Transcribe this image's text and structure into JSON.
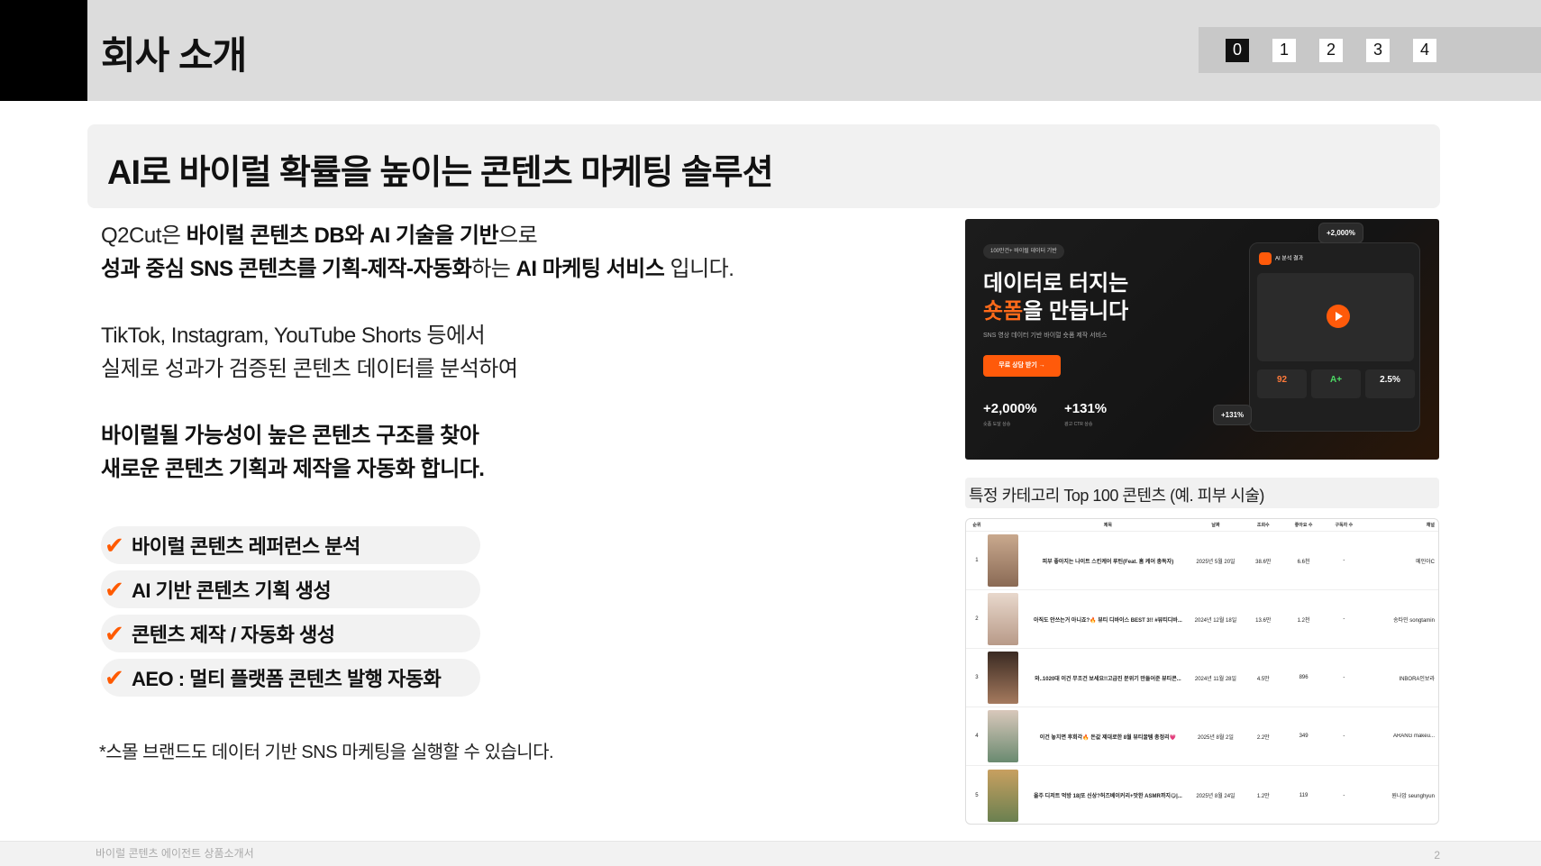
{
  "header": {
    "title": "회사 소개",
    "pages": [
      "0",
      "1",
      "2",
      "3",
      "4"
    ],
    "active_page": "0"
  },
  "headline": "AI로 바이럴 확률을 높이는 콘텐츠 마케팅 솔루션",
  "intro": {
    "p1_a": "Q2Cut은 ",
    "p1_b": "바이럴 콘텐츠 DB와 AI 기술을 기반",
    "p1_c": "으로",
    "p1_d": "성과 중심 SNS 콘텐츠를 기획-제작-자동화",
    "p1_e": "하는 ",
    "p1_f": "AI 마케팅 서비스",
    "p1_g": " 입니다.",
    "p2_line1": "TikTok, Instagram, YouTube Shorts 등에서",
    "p2_line2": "실제로 성과가 검증된 콘텐츠 데이터를 분석하여",
    "p3_line1": "바이럴될 가능성이 높은 콘텐츠 구조를 찾아",
    "p3_line2": "새로운 콘텐츠 기획과 제작을 자동화 합니다."
  },
  "features": [
    "바이럴 콘텐츠 레퍼런스 분석",
    "AI 기반 콘텐츠 기획 생성",
    "콘텐츠 제작 / 자동화 생성",
    "AEO : 멀티 플랫폼 콘텐츠 발행 자동화"
  ],
  "check_glyph": "✔",
  "accent_color": "#ff5a00",
  "footnote": "*스몰 브랜드도 데이터 기반 SNS 마케팅을 실행할 수 있습니다.",
  "hero": {
    "badge": "100만건+ 바이럴 데이터 기반",
    "title_line1": "데이터로 터지는",
    "title_hl": "숏폼",
    "title_line2_rest": "을 만듭니다",
    "subtitle": "SNS 영상 데이터 기반 바이럴 숏폼 제작 서비스",
    "cta": "무료 상담 받기 →",
    "stat1": "+2,000%",
    "stat1_sub": "숏폼 도달 상승",
    "stat2": "+131%",
    "stat2_sub": "광고 CTR 상승",
    "panel_title": "AI 분석 결과",
    "metric1": "92",
    "metric2": "A+",
    "metric3": "2.5%",
    "float1": "+2,000%",
    "float2": "+131%"
  },
  "caption": "특정 카테고리 Top 100 콘텐츠 (예. 피부 시술)",
  "table": {
    "headers": [
      "순위",
      "제목",
      "날짜",
      "조회수",
      "좋아요 수",
      "구독자 수",
      "채널"
    ],
    "rows": [
      {
        "rank": "1",
        "title": "피부 좋아지는 나이트 스킨케어 루틴(Feat. 홈 케어 총독자)",
        "date": "2025년 5월 20일",
        "views": "38.6만",
        "likes": "6.6천",
        "subs": "-",
        "channel": "메인아C"
      },
      {
        "rank": "2",
        "title": "아직도 안쓰는거 아니죠?🔥 뷰티 디바이스 BEST 3!! #뷰티디바...",
        "date": "2024년 12월 18일",
        "views": "13.6만",
        "likes": "1.2천",
        "subs": "-",
        "channel": "송타민 songtamin"
      },
      {
        "rank": "3",
        "title": "와..1020대 이건 무조건 보세요!!고급진 분위기 만들어준 뷰티콘...",
        "date": "2024년 11월 28일",
        "views": "4.5만",
        "likes": "896",
        "subs": "-",
        "channel": "INBORA인보라"
      },
      {
        "rank": "4",
        "title": "이건 놓치면 후회각🔥 돈값 제대로한 8월 뷰티꿀템 총정리💗",
        "date": "2025년 8월 2일",
        "views": "2.2만",
        "likes": "349",
        "subs": "-",
        "channel": "ARANG makeu..."
      },
      {
        "rank": "5",
        "title": "올주 디저트 먹방 18|또 신상?허즈베이커리+맛한 ASMR까지😋|...",
        "date": "2025년 8월 24일",
        "views": "1.2만",
        "likes": "119",
        "subs": "-",
        "channel": "원나암 seunghyun"
      }
    ]
  },
  "footer": {
    "left": "바이럴 콘텐츠 에이전트 상품소개서",
    "page": "2"
  }
}
